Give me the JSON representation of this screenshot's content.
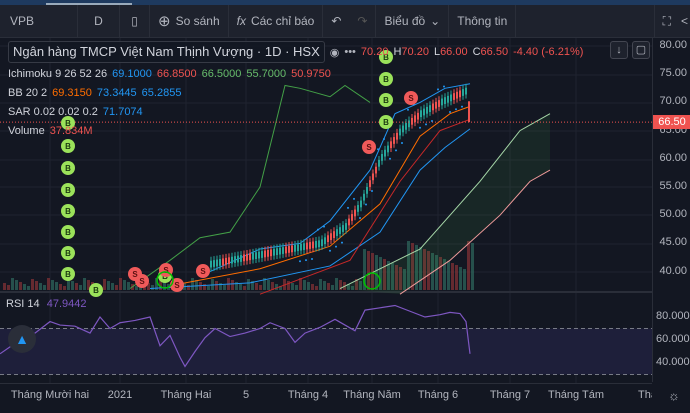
{
  "toolbar": {
    "symbol": "VPB",
    "interval": "D",
    "compare": "So sánh",
    "indicators": "Các chỉ báo",
    "chart": "Biểu đồ",
    "info": "Thông tin"
  },
  "legend": {
    "title": "Ngân hàng TMCP Việt Nam Thịnh Vượng · 1D · HSX",
    "ohlc": {
      "o": "70.20",
      "h_label": "H",
      "h": "70.20",
      "l_label": "L",
      "l": "66.00",
      "c_label": "C",
      "c": "66.50",
      "change": "-4.40 (-6.21%)"
    },
    "ichimoku": {
      "label": "Ichimoku 9 26 52 26",
      "v": [
        "69.1000",
        "66.8500",
        "66.5000",
        "55.7000",
        "50.9750"
      ]
    },
    "bb": {
      "label": "BB 20 2",
      "v": [
        "69.3150",
        "73.3445",
        "65.2855"
      ]
    },
    "sar": {
      "label": "SAR 0.02 0.02 0.2",
      "v": "71.7074"
    },
    "volume": {
      "label": "Volume",
      "v": "37.834M"
    },
    "rsi": {
      "label": "RSI 14",
      "v": "47.9442"
    }
  },
  "price_axis": [
    "80.00",
    "75.00",
    "70.00",
    "65.00",
    "60.00",
    "55.00",
    "50.00",
    "45.00",
    "40.00"
  ],
  "last_price": "66.50",
  "rsi_axis": [
    "80.0000",
    "60.0000",
    "40.0000"
  ],
  "time_axis": [
    "Tháng Mười hai",
    "2021",
    "Tháng Hai",
    "5",
    "Tháng 4",
    "Tháng Năm",
    "Tháng 6",
    "Tháng 7",
    "Tháng Tám",
    "Tháng"
  ],
  "markers": {
    "buy": "B",
    "sell": "S"
  },
  "colors": {
    "up": "#26a69a",
    "down": "#ef5350",
    "bb": "#2196f3",
    "bb_mid": "#ff6d00",
    "rsi": "#7e57c2",
    "buy": "#9be25a",
    "sell": "#f05a5a",
    "chikou": "#43a047"
  }
}
